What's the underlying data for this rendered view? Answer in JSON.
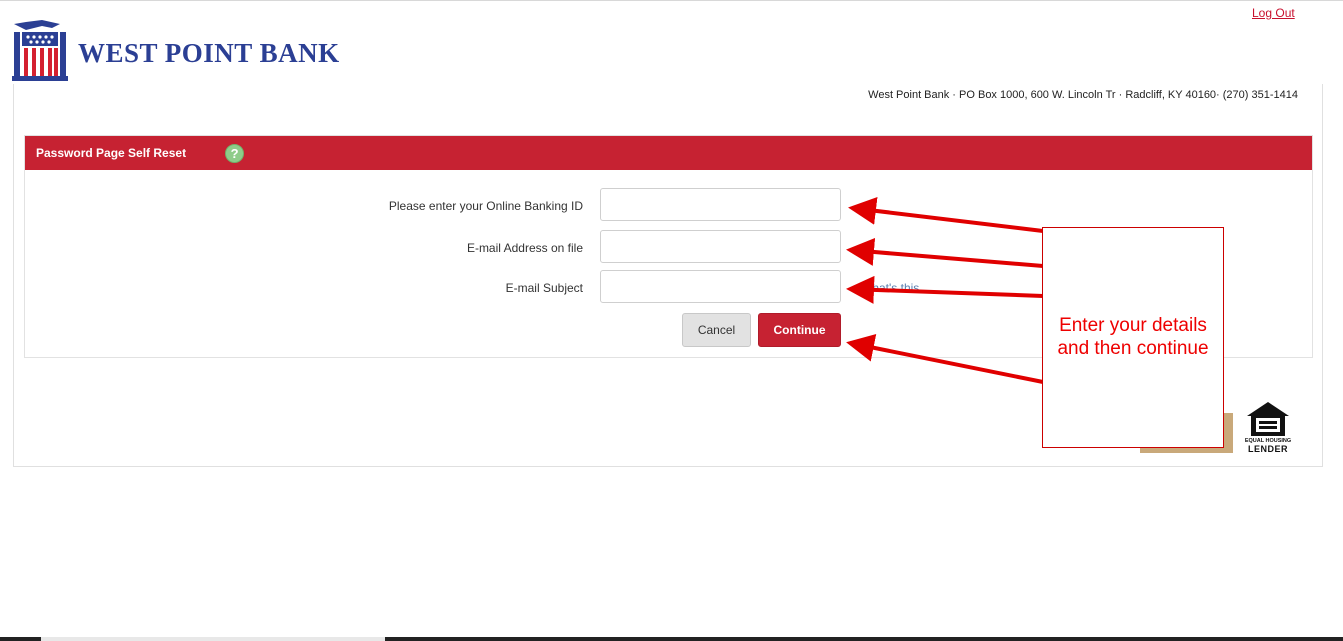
{
  "header": {
    "logout_label": "Log Out",
    "bank_name": "WEST POINT BANK",
    "address": "West Point Bank · PO Box 1000, 600 W. Lincoln Tr · Radcliff, KY 40160· (270) 351-1414"
  },
  "reset_form": {
    "title": "Password Page Self Reset",
    "help_icon": "question-mark-icon",
    "fields": [
      {
        "label": "Please enter your Online Banking ID",
        "value": ""
      },
      {
        "label": "E-mail Address on file",
        "value": ""
      },
      {
        "label": "E-mail Subject",
        "value": ""
      }
    ],
    "whats_this": "What's this",
    "cancel_label": "Cancel",
    "continue_label": "Continue"
  },
  "footer": {
    "equal_housing_line1": "EQUAL HOUSING",
    "equal_housing_line2": "LENDER"
  },
  "annotation": {
    "callout_text_line1": "Enter your details",
    "callout_text_line2": "and then continue"
  },
  "colors": {
    "brand_red": "#c62232",
    "brand_blue": "#2b3f94",
    "callout_red": "#e00000"
  }
}
